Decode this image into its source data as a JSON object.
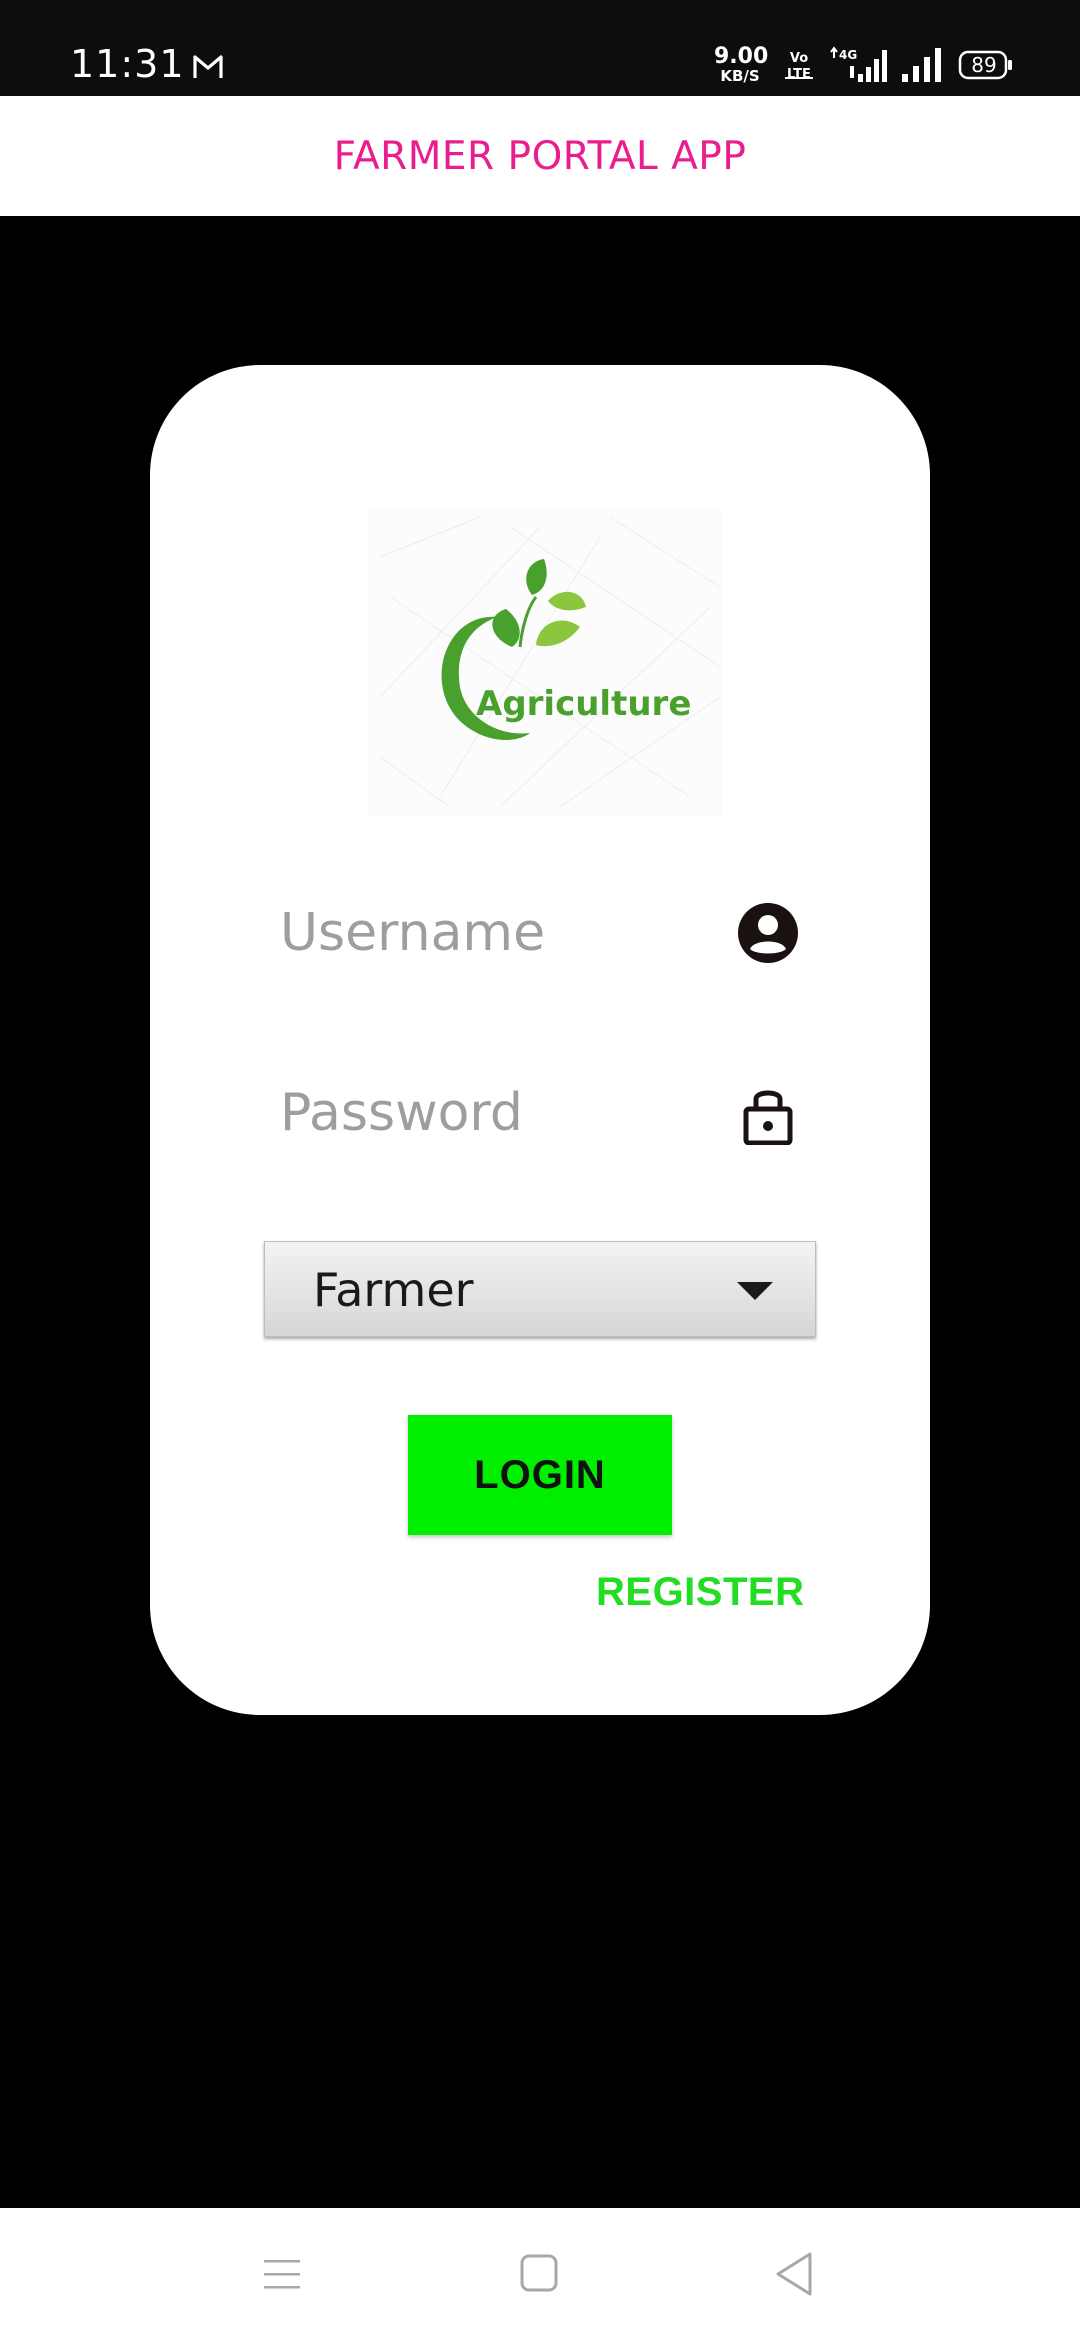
{
  "status_bar": {
    "time": "11:31",
    "net_speed_value": "9.00",
    "net_speed_unit": "KB/S",
    "battery_level": "89",
    "icons": [
      "gmail-icon",
      "volte-icon",
      "signal-4g-icon",
      "signal-icon",
      "battery-icon"
    ]
  },
  "app_bar": {
    "title": "FARMER PORTAL APP",
    "title_color": "#e91e8c"
  },
  "login_card": {
    "logo_text": "Agriculture",
    "username": {
      "value": "",
      "placeholder": "Username",
      "icon": "account-circle-icon"
    },
    "password": {
      "value": "",
      "placeholder": "Password",
      "icon": "lock-icon"
    },
    "role_select": {
      "selected": "Farmer",
      "icon": "chevron-down-icon"
    },
    "login_label": "LOGIN",
    "register_label": "REGISTER",
    "accent_color": "#00ee00"
  },
  "nav_bar": {
    "icons": [
      "menu-icon",
      "home-square-icon",
      "back-triangle-icon"
    ]
  }
}
